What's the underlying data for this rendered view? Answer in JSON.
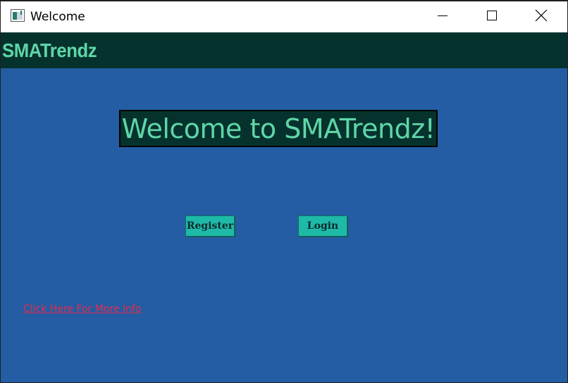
{
  "window": {
    "title": "Welcome"
  },
  "header": {
    "brand": "SMATrendz"
  },
  "main": {
    "welcome_text": "Welcome to SMATrendz!",
    "register_label": "Register",
    "login_label": "Login",
    "info_link": "Click Here For More Info"
  },
  "colors": {
    "background": "#245da3",
    "header_bg": "#06322e",
    "accent_text": "#5fd6a6",
    "button_bg": "#1fb9a8",
    "link": "#e52a4c"
  },
  "icons": {
    "app": "app-window-icon",
    "minimize": "minimize-icon",
    "maximize": "maximize-icon",
    "close": "close-icon"
  }
}
